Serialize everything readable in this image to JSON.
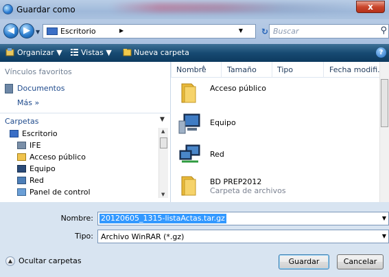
{
  "window": {
    "title": "Guardar como",
    "close_label": "x"
  },
  "address": {
    "location": "Escritorio",
    "search_placeholder": "Buscar"
  },
  "toolbar": {
    "organize": "Organizar",
    "views": "Vistas",
    "new_folder": "Nueva carpeta"
  },
  "favorites": {
    "header": "Vínculos favoritos",
    "items": [
      "Documentos"
    ],
    "more": "Más »"
  },
  "folders": {
    "header": "Carpetas",
    "items": [
      "Escritorio",
      "IFE",
      "Acceso público",
      "Equipo",
      "Red",
      "Panel de control"
    ]
  },
  "columns": [
    "Nombre",
    "Tamaño",
    "Tipo",
    "Fecha modifi..."
  ],
  "files": [
    {
      "name": "Acceso público",
      "sub": ""
    },
    {
      "name": "Equipo",
      "sub": ""
    },
    {
      "name": "Red",
      "sub": ""
    },
    {
      "name": "BD PREP2012",
      "sub": "Carpeta de archivos"
    }
  ],
  "fields": {
    "name_label": "Nombre:",
    "name_value": "20120605_1315-listaActas.tar.gz",
    "type_label": "Tipo:",
    "type_value": "Archivo WinRAR (*.gz)"
  },
  "actions": {
    "hide_folders": "Ocultar carpetas",
    "save": "Guardar",
    "cancel": "Cancelar"
  },
  "colors": {
    "toolbar": "#174a72",
    "selection": "#3399ff",
    "close": "#c9462c"
  }
}
